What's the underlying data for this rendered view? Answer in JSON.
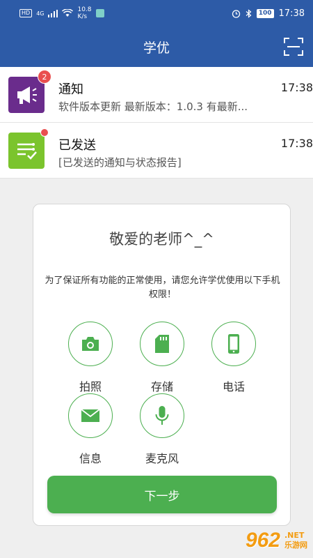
{
  "status_bar": {
    "hd": "HD",
    "net": "4G",
    "speed_value": "10.8",
    "speed_unit": "K/s",
    "battery": "100",
    "time": "17:38"
  },
  "app_bar": {
    "title": "学优",
    "scan_icon": "scan-icon"
  },
  "list": [
    {
      "title": "通知",
      "subtitle": "软件版本更新 最新版本：1.0.3 有最新...",
      "time": "17:38",
      "badge": "2",
      "icon": "megaphone-icon",
      "color": "#6a2c8c"
    },
    {
      "title": "已发送",
      "subtitle": "[已发送的通知与状态报告]",
      "time": "17:38",
      "badge": "",
      "icon": "checklist-icon",
      "color": "#7bc42d"
    }
  ],
  "dialog": {
    "title": "敬爱的老师^_^",
    "message": "为了保证所有功能的正常使用，请您允许学优使用以下手机权限！",
    "permissions": [
      {
        "label": "拍照",
        "icon": "camera-icon"
      },
      {
        "label": "存储",
        "icon": "sdcard-icon"
      },
      {
        "label": "电话",
        "icon": "phone-icon"
      },
      {
        "label": "信息",
        "icon": "message-icon"
      },
      {
        "label": "麦克风",
        "icon": "microphone-icon"
      }
    ],
    "next_button": "下一步"
  },
  "watermark": {
    "logo": "962",
    "suffix": ".NET",
    "name": "乐游网"
  },
  "colors": {
    "primary": "#2d5ba7",
    "accent": "#4caf50",
    "badge": "#e94f4f"
  }
}
